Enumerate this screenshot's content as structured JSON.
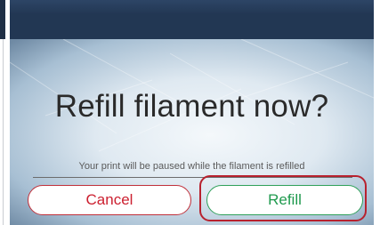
{
  "dialog": {
    "title": "Refill filament now?",
    "message": "Your print will be paused while the filament is refilled",
    "cancel_label": "Cancel",
    "confirm_label": "Refill"
  },
  "colors": {
    "title_bar": "#223753",
    "cancel": "#cc2030",
    "confirm": "#1f9a4e",
    "highlight": "#b8212e"
  }
}
